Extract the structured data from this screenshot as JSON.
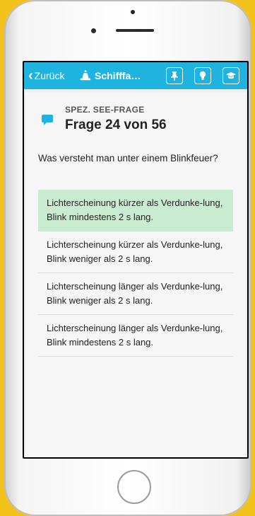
{
  "navbar": {
    "back_label": "Zurück",
    "title": "Schifffa…",
    "icons": [
      "pin-icon",
      "lightbulb-icon",
      "graduation-cap-icon"
    ],
    "color": "#1fb3e0"
  },
  "question": {
    "category": "SPEZ. SEE-FRAGE",
    "number_label": "Frage 24 von 56",
    "text": "Was versteht man unter einem Blinkfeuer?"
  },
  "answers": [
    {
      "text": "Lichterscheinung kürzer als Verdunke-lung, Blink mindestens 2 s lang.",
      "correct": true
    },
    {
      "text": "Lichterscheinung kürzer als Verdunke-lung, Blink weniger als 2 s lang.",
      "correct": false
    },
    {
      "text": "Lichterscheinung länger als Verdunke-lung, Blink weniger als 2 s lang.",
      "correct": false
    },
    {
      "text": "Lichterscheinung länger als Verdunke-lung, Blink mindestens 2 s lang.",
      "correct": false
    }
  ],
  "colors": {
    "correct_bg": "#c9ecd0",
    "background": "#f3c21b"
  }
}
